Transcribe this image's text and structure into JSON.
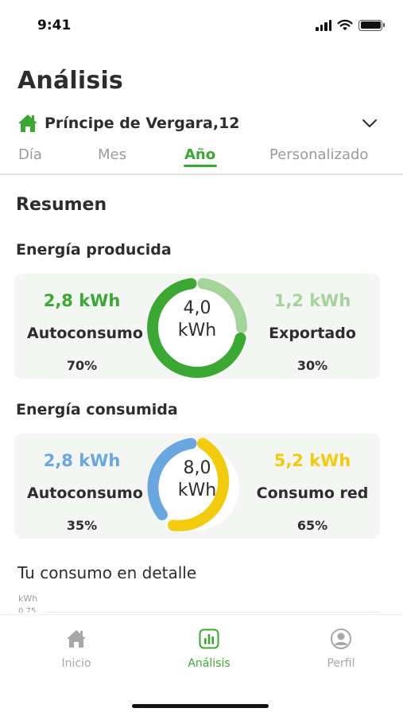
{
  "status_bar": {
    "time": "9:41"
  },
  "header": {
    "title": "Análisis",
    "location": "Príncipe de Vergara,12"
  },
  "tabs": [
    {
      "label": "Día",
      "active": false
    },
    {
      "label": "Mes",
      "active": false
    },
    {
      "label": "Año",
      "active": true
    },
    {
      "label": "Personalizado",
      "active": false
    }
  ],
  "summary": {
    "heading": "Resumen",
    "produced": {
      "title": "Energía producida",
      "total_value": "4,0",
      "total_unit": "kWh",
      "left": {
        "value": "2,8 kWh",
        "label": "Autoconsumo",
        "percent": "70%",
        "color": "#3aa833"
      },
      "right": {
        "value": "1,2 kWh",
        "label": "Exportado",
        "percent": "30%",
        "color": "#a5d49a"
      }
    },
    "consumed": {
      "title": "Energía consumida",
      "total_value": "8,0",
      "total_unit": "kWh",
      "left": {
        "value": "2,8 kWh",
        "label": "Autoconsumo",
        "percent": "35%",
        "color": "#6aa6e0"
      },
      "right": {
        "value": "5,2 kWh",
        "label": "Consumo red",
        "percent": "65%",
        "color": "#f2cc0c"
      }
    }
  },
  "detail": {
    "title": "Tu consumo en detalle",
    "unit": "kWh",
    "first_tick": "0,75"
  },
  "nav": [
    {
      "label": "Inicio",
      "icon": "home-icon",
      "active": false
    },
    {
      "label": "Análisis",
      "icon": "chart-icon",
      "active": true
    },
    {
      "label": "Perfil",
      "icon": "profile-icon",
      "active": false
    }
  ],
  "colors": {
    "accent": "#3aa833",
    "text": "#2d2d2d",
    "inactive": "#9b9b9b"
  }
}
